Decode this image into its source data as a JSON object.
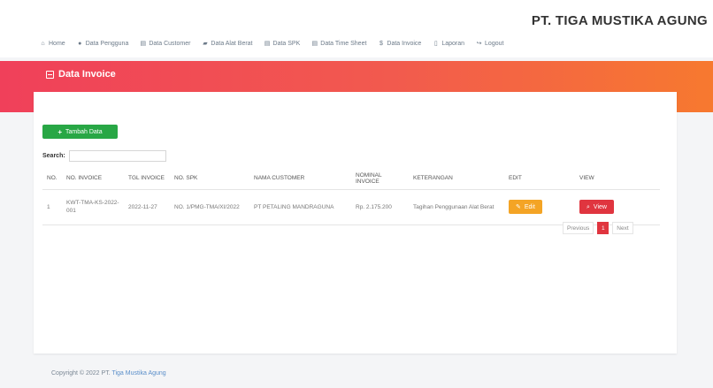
{
  "brand": "PT. TIGA MUSTIKA AGUNG",
  "nav": [
    {
      "icon": "home-icon",
      "label": "Home"
    },
    {
      "icon": "user-icon",
      "label": "Data Pengguna"
    },
    {
      "icon": "list-icon",
      "label": "Data Customer"
    },
    {
      "icon": "truck-icon",
      "label": "Data Alat Berat"
    },
    {
      "icon": "list-icon",
      "label": "Data SPK"
    },
    {
      "icon": "list-icon",
      "label": "Data Time Sheet"
    },
    {
      "icon": "dollar-icon",
      "label": "Data Invoice"
    },
    {
      "icon": "file-icon",
      "label": "Laporan"
    },
    {
      "icon": "logout-icon",
      "label": "Logout"
    }
  ],
  "page_title": "Data Invoice",
  "add_button": "Tambah Data",
  "search": {
    "label": "Search:",
    "value": ""
  },
  "table": {
    "headers": [
      "NO.",
      "NO. INVOICE",
      "TGL INVOICE",
      "NO. SPK",
      "NAMA CUSTOMER",
      "NOMINAL INVOICE",
      "KETERANGAN",
      "EDIT",
      "VIEW"
    ],
    "rows": [
      {
        "no": "1",
        "invoice": "KWT-TMA-KS-2022-001",
        "date": "2022-11-27",
        "spk": "NO. 1/PMG-TMA/XI/2022",
        "customer": "PT PETALING MANDRAGUNA",
        "nominal": "Rp. 2.175.200",
        "note": "Tagihan Penggunaan Alat Berat",
        "edit": "Edit",
        "view": "View"
      }
    ]
  },
  "pager": {
    "prev": "Previous",
    "current": "1",
    "next": "Next"
  },
  "footer": {
    "text": "Copyright © 2022 PT.",
    "link": "Tiga Mustika Agung"
  },
  "colors": {
    "accent_red": "#e0353f",
    "accent_orange": "#f7792f",
    "success": "#28a745",
    "warning": "#f4a425"
  }
}
